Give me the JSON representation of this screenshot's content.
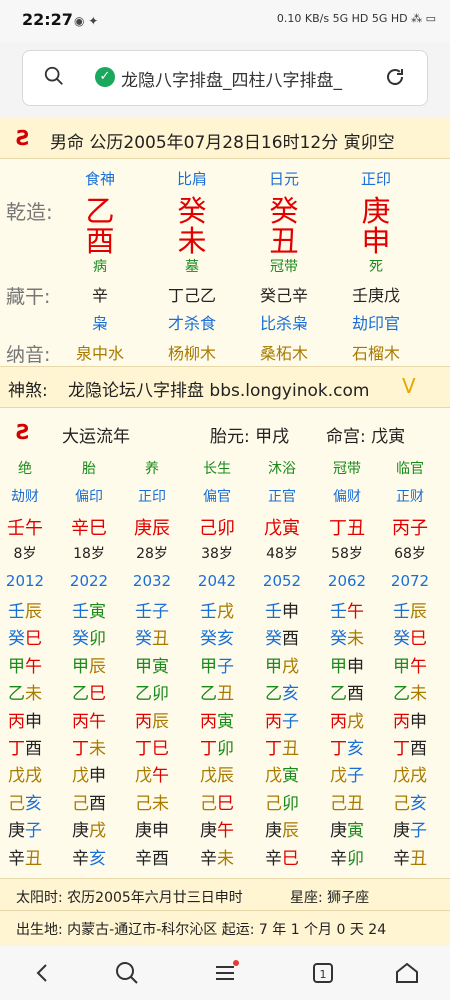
{
  "status": {
    "time": "22:27",
    "right": "0.10 KB/s  5G HD  5G HD  ⁂  ▭"
  },
  "browser": {
    "title": "龙隐八字排盘_四柱八字排盘_"
  },
  "header": {
    "info": "男命 公历2005年07月28日16时12分 寅卯空"
  },
  "pillars": {
    "label_qz": "乾造:",
    "label_cg": "藏干:",
    "label_ny": "纳音:",
    "shishen": [
      "食神",
      "比肩",
      "日元",
      "正印"
    ],
    "gan": [
      "乙",
      "癸",
      "癸",
      "庚"
    ],
    "zhi": [
      "酉",
      "未",
      "丑",
      "申"
    ],
    "changsheng": [
      "病",
      "墓",
      "冠带",
      "死"
    ],
    "canggan": [
      "辛",
      "丁己乙",
      "癸己辛",
      "壬庚戊"
    ],
    "canggan_shen": [
      "枭",
      "才杀食",
      "比杀枭",
      "劫印官"
    ],
    "nayin": [
      "泉中水",
      "杨柳木",
      "桑柘木",
      "石榴木"
    ]
  },
  "shensha": {
    "key": "神煞:",
    "value": "龙隐论坛八字排盘 bbs.longyinok.com",
    "arrow": "V"
  },
  "dayun": {
    "title": "大运流年",
    "taiyuan": "胎元: 甲戌",
    "minggong": "命宫: 戊寅",
    "changsheng": [
      "绝",
      "胎",
      "养",
      "长生",
      "沐浴",
      "冠带",
      "临官"
    ],
    "shishen": [
      "劫财",
      "偏印",
      "正印",
      "偏官",
      "正官",
      "偏财",
      "正财"
    ],
    "ganzhi": [
      "壬午",
      "辛巳",
      "庚辰",
      "己卯",
      "戊寅",
      "丁丑",
      "丙子"
    ],
    "age": [
      "8岁",
      "18岁",
      "28岁",
      "38岁",
      "48岁",
      "58岁",
      "68岁"
    ],
    "year": [
      "2012",
      "2022",
      "2032",
      "2042",
      "2052",
      "2062",
      "2072"
    ]
  },
  "liunian": [
    [
      "壬辰",
      "壬寅",
      "壬子",
      "壬戌",
      "壬申",
      "壬午",
      "壬辰"
    ],
    [
      "癸巳",
      "癸卯",
      "癸丑",
      "癸亥",
      "癸酉",
      "癸未",
      "癸巳"
    ],
    [
      "甲午",
      "甲辰",
      "甲寅",
      "甲子",
      "甲戌",
      "甲申",
      "甲午"
    ],
    [
      "乙未",
      "乙巳",
      "乙卯",
      "乙丑",
      "乙亥",
      "乙酉",
      "乙未"
    ],
    [
      "丙申",
      "丙午",
      "丙辰",
      "丙寅",
      "丙子",
      "丙戌",
      "丙申"
    ],
    [
      "丁酉",
      "丁未",
      "丁巳",
      "丁卯",
      "丁丑",
      "丁亥",
      "丁酉"
    ],
    [
      "戊戌",
      "戊申",
      "戊午",
      "戊辰",
      "戊寅",
      "戊子",
      "戊戌"
    ],
    [
      "己亥",
      "己酉",
      "己未",
      "己巳",
      "己卯",
      "己丑",
      "己亥"
    ],
    [
      "庚子",
      "庚戌",
      "庚申",
      "庚午",
      "庚辰",
      "庚寅",
      "庚子"
    ],
    [
      "辛丑",
      "辛亥",
      "辛酉",
      "辛未",
      "辛巳",
      "辛卯",
      "辛丑"
    ]
  ],
  "footer": {
    "solar": "太阳时: 农历2005年六月廿三日申时",
    "star": "星座: 狮子座",
    "birth": "出生地: 内蒙古-通辽市-科尔沁区 起运: 7 年 1 个月 0 天 24"
  },
  "colors": {
    "red": "#e00000",
    "blue": "#1a6fd6",
    "green": "#1a8a1a",
    "gold": "#a87a00"
  }
}
